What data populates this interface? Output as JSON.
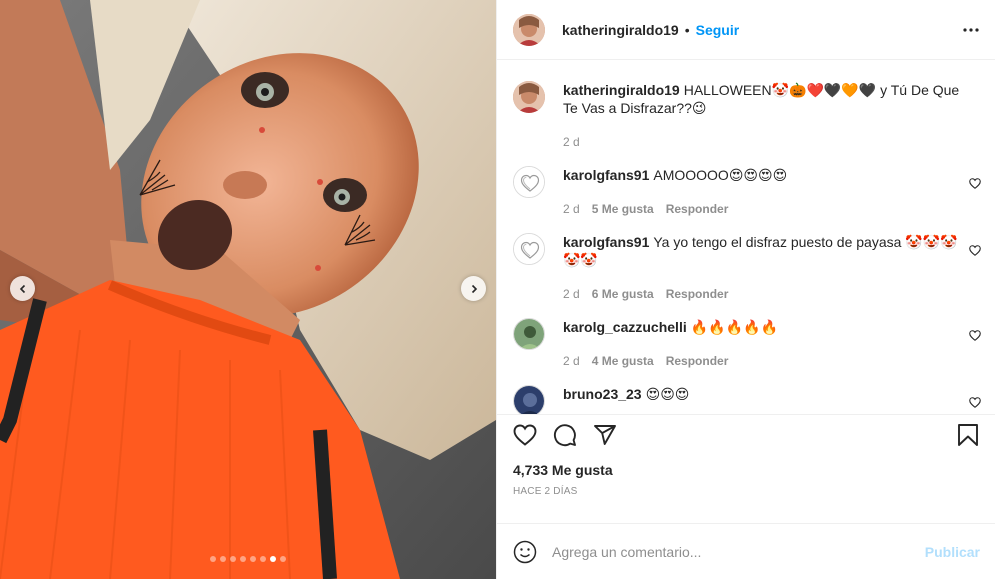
{
  "header": {
    "username": "katheringiraldo19",
    "separator": "•",
    "follow_label": "Seguir"
  },
  "caption": {
    "username": "katheringiraldo19",
    "text": "HALLOWEEN🤡🎃❤️🖤🧡🖤 y Tú De Que Te Vas a Disfrazar??😉",
    "time": "2 d"
  },
  "comments": [
    {
      "username": "karolgfans91",
      "text": "AMOOOOO😍😍😍😍",
      "time": "2 d",
      "likes": "5 Me gusta",
      "reply": "Responder",
      "avatar": "heart-outline"
    },
    {
      "username": "karolgfans91",
      "text": "Ya yo tengo el disfraz puesto de payasa 🤡🤡🤡🤡🤡",
      "time": "2 d",
      "likes": "6 Me gusta",
      "reply": "Responder",
      "avatar": "heart-outline"
    },
    {
      "username": "karolg_cazzuchelli",
      "text": "🔥🔥🔥🔥🔥",
      "time": "2 d",
      "likes": "4 Me gusta",
      "reply": "Responder",
      "avatar": "photo"
    },
    {
      "username": "bruno23_23",
      "text": "😍😍😍",
      "time": "",
      "likes": "",
      "reply": "",
      "avatar": "photo-dark"
    }
  ],
  "stats": {
    "likes": "4,733 Me gusta",
    "time_ago": "HACE 2 DÍAS"
  },
  "composer": {
    "placeholder": "Agrega un comentario...",
    "post_label": "Publicar"
  },
  "carousel": {
    "total": 8,
    "active_index": 6
  },
  "colors": {
    "accent": "#0095f6",
    "post_disabled": "#b2dffc",
    "muted": "#8e8e8e",
    "text": "#262626",
    "shirt": "#ff5a1f"
  },
  "icons": {
    "more": "more-horizontal-icon",
    "like": "heart-icon",
    "comment": "comment-icon",
    "share": "share-icon",
    "save": "bookmark-icon",
    "emoji": "emoji-icon",
    "prev": "chevron-left-icon",
    "next": "chevron-right-icon"
  }
}
